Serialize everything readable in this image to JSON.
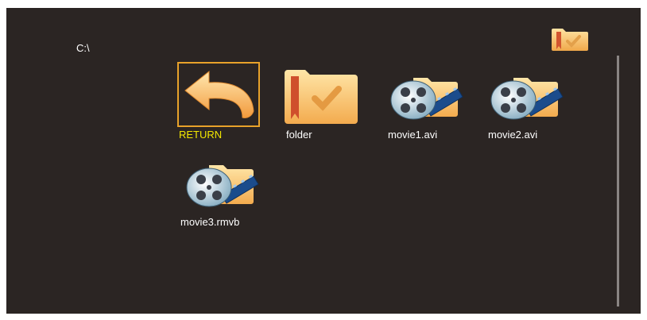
{
  "path": "C:\\",
  "top_icon": "folder-bookmark-icon",
  "items": [
    {
      "label": "RETURN",
      "icon": "return-arrow-icon",
      "selected": true
    },
    {
      "label": "folder",
      "icon": "folder-icon",
      "selected": false
    },
    {
      "label": "movie1.avi",
      "icon": "movie-file-icon",
      "selected": false
    },
    {
      "label": "movie2.avi",
      "icon": "movie-file-icon",
      "selected": false
    },
    {
      "label": "movie3.rmvb",
      "icon": "movie-file-icon",
      "selected": false
    }
  ],
  "colors": {
    "background": "#2b2523",
    "selection_border": "#e8a22a",
    "selected_label": "#f2e600",
    "label": "#ffffff"
  }
}
